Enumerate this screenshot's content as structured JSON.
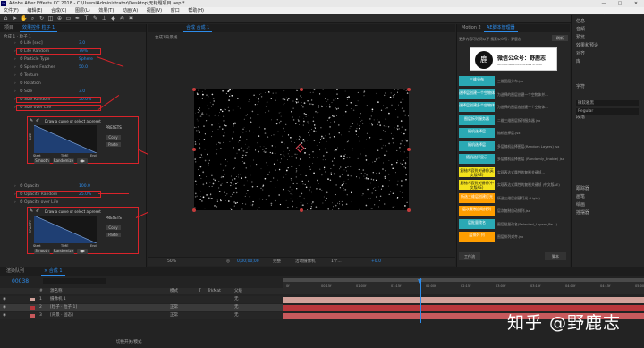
{
  "app": {
    "title": "Adobe After Effects CC 2018 - C:\\Users\\Administrator\\Desktop\\无标题项目.aep *"
  },
  "window_controls": {
    "minimize": "—",
    "maximize": "□",
    "close": "✕"
  },
  "menu": [
    "文件(F)",
    "编辑(E)",
    "合成(C)",
    "图层(L)",
    "效果(T)",
    "动画(A)",
    "视图(V)",
    "窗口",
    "帮助(H)"
  ],
  "search": {
    "placeholder": "搜索帮助"
  },
  "effect_controls": {
    "tabs": [
      "项目",
      "效果控件 粒子 1",
      "× 合成 1"
    ],
    "breadcrumb": "合成 1 · 粒子 1",
    "params": [
      {
        "name": "Life [sec]",
        "value": "3.0",
        "highlight": false
      },
      {
        "name": "Life Random",
        "value": "79%",
        "highlight": true
      },
      {
        "name": "Particle Type",
        "value": "Sphere",
        "highlight": false
      },
      {
        "name": "Sphere Feather",
        "value": "50.0",
        "highlight": false
      },
      {
        "name": "Texture",
        "value": "",
        "highlight": false
      },
      {
        "name": "Rotation",
        "value": "",
        "highlight": false
      },
      {
        "name": "Size",
        "value": "3.0",
        "highlight": false
      },
      {
        "name": "Size Random",
        "value": "50.0%",
        "highlight": true
      },
      {
        "name": "Size over Life",
        "value": "",
        "highlight": true
      }
    ],
    "params2": [
      {
        "name": "Opacity",
        "value": "100.0",
        "highlight": false
      },
      {
        "name": "Opacity Random",
        "value": "25.0%",
        "highlight": true
      },
      {
        "name": "Opacity over Life",
        "value": "",
        "highlight": false
      }
    ],
    "graph": {
      "prompt": "Draw a curve or select a preset",
      "presets": "PRESETS",
      "copy": "Copy",
      "paste": "Paste",
      "start": "Start",
      "time": "TIME",
      "end": "End",
      "smooth": "Smooth",
      "randomize": "Randomize",
      "size_axis": "SIZE",
      "opacity_axis": "OPACITY"
    }
  },
  "comp": {
    "tab": "合成 合成 1",
    "label": "合成1背景线",
    "zoom": "50%",
    "timecode": "0;00;00;00",
    "quality": "完整",
    "camera": "活动摄像机",
    "views": "1个...",
    "extra": "+0.0"
  },
  "script_panel": {
    "tabs": [
      "Motion 2",
      "AE脚本管理器"
    ],
    "filter": "更多内容可访问以下 搜索公众号：野鹿志",
    "action": "刷新",
    "logo_text": "微信公众号：野鹿志",
    "logo_sub": "MOTION GRAPHICS DESIGN STUDIO",
    "items": [
      {
        "label": "三维分布",
        "desc": "三维图层分布.jsx"
      },
      {
        "label": "选择层创建一个空物体",
        "desc": "为选择的图层创建一个空物体并..."
      },
      {
        "label": "选择层创建多个空物体",
        "desc": "为选择的图层各创建一个空物体..."
      },
      {
        "label": "图层拆列服务器",
        "desc": "二维三维图层拆列服务器 jsx"
      },
      {
        "label": "随机选择层",
        "desc": "随机选择层.jsx"
      },
      {
        "label": "随机选择层",
        "desc": "多层随机选择图层(Random Layers) jsx"
      },
      {
        "label": "随机选择显示",
        "desc": "多层随机选择图层 (Randomly_Enable) jsx"
      },
      {
        "label": "复制内容到关键帧(英文版AE)",
        "desc": "实现表达式属性的复制关键帧..."
      },
      {
        "label": "复制内容到关键帧(中文版AE)",
        "desc": "实现表达式属性的复制关键帧 (中文版AE)"
      },
      {
        "label": "所选三维层创建灯光",
        "desc": "所选三维层创建灯光 (Light)..."
      },
      {
        "label": "层次复制自动排列",
        "desc": "层次复制自动排列.jsx"
      },
      {
        "label": "层批量改名",
        "desc": "图层批量改名(Selected_Layers_Re...)"
      },
      {
        "label": "层排列 列",
        "desc": "图层排列对齐.jsx"
      }
    ],
    "footer": [
      "工作流",
      "脚本"
    ]
  },
  "right_panel": {
    "items": [
      "信息",
      "音频",
      "预览",
      "效果和预设",
      "对齐",
      "库",
      "字符",
      "段落",
      "跟踪器",
      "画笔",
      "绘画",
      "摇摆器"
    ],
    "char_font": "微软雅黑",
    "char_style": "Regular"
  },
  "timeline": {
    "tabs": [
      "渲染队列",
      "× 合成 1"
    ],
    "timecode": "00038",
    "columns": [
      "#",
      "源名称",
      "模式",
      "T",
      "TrkMat",
      "父级"
    ],
    "layers": [
      {
        "num": "1",
        "name": "摄像机 1",
        "mode": "",
        "parent": "无",
        "color": "#d1a19a"
      },
      {
        "num": "2",
        "name": "[粒子 · 粒子 1]",
        "mode": "正常",
        "parent": "无",
        "color": "#b8363b"
      },
      {
        "num": "3",
        "name": "[背景 · 固态]",
        "mode": "正常",
        "parent": "无",
        "color": "#c8595c"
      }
    ],
    "ruler": [
      "0f",
      "00:15f",
      "01:00f",
      "01:15f",
      "02:00f",
      "02:15f",
      "03:00f",
      "03:15f",
      "04:00f",
      "04:15f",
      "05:00f"
    ],
    "footer": "切换开关/模式"
  },
  "watermark": "知乎 @野鹿志"
}
